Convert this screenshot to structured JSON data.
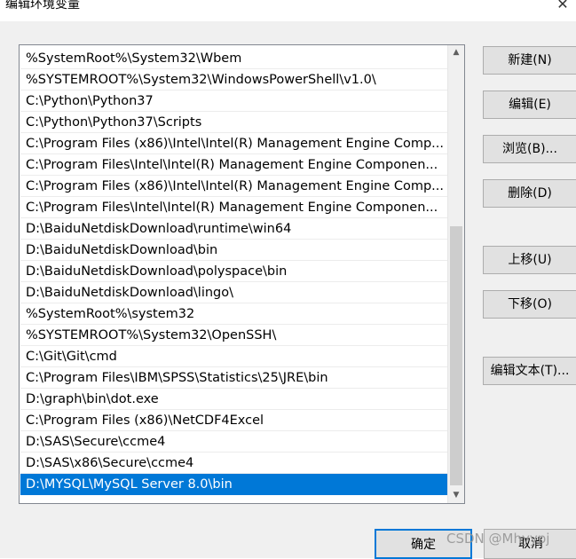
{
  "window": {
    "title": "编辑环境变量"
  },
  "paths": [
    "%SystemRoot%\\System32\\Wbem",
    "%SYSTEMROOT%\\System32\\WindowsPowerShell\\v1.0\\",
    "C:\\Python\\Python37",
    "C:\\Python\\Python37\\Scripts",
    "C:\\Program Files (x86)\\Intel\\Intel(R) Management Engine Comp...",
    "C:\\Program Files\\Intel\\Intel(R) Management Engine Componen...",
    "C:\\Program Files (x86)\\Intel\\Intel(R) Management Engine Comp...",
    "C:\\Program Files\\Intel\\Intel(R) Management Engine Componen...",
    "D:\\BaiduNetdiskDownload\\runtime\\win64",
    "D:\\BaiduNetdiskDownload\\bin",
    "D:\\BaiduNetdiskDownload\\polyspace\\bin",
    "D:\\BaiduNetdiskDownload\\lingo\\",
    "%SystemRoot%\\system32",
    "%SYSTEMROOT%\\System32\\OpenSSH\\",
    "C:\\Git\\Git\\cmd",
    "C:\\Program Files\\IBM\\SPSS\\Statistics\\25\\JRE\\bin",
    "D:\\graph\\bin\\dot.exe",
    "C:\\Program Files (x86)\\NetCDF4Excel",
    "D:\\SAS\\Secure\\ccme4",
    "D:\\SAS\\x86\\Secure\\ccme4",
    "D:\\MYSQL\\MySQL Server 8.0\\bin"
  ],
  "selected_index": 20,
  "buttons": {
    "new": "新建(N)",
    "edit": "编辑(E)",
    "browse": "浏览(B)...",
    "delete": "删除(D)",
    "move_up": "上移(U)",
    "move_down": "下移(O)",
    "edit_text": "编辑文本(T)...",
    "ok": "确定",
    "cancel": "取消"
  },
  "watermark": "CSDN @Mhyypj",
  "icons": {
    "close": "close-icon",
    "scroll_up": "scroll-up-arrow-icon",
    "scroll_down": "scroll-down-arrow-icon"
  }
}
